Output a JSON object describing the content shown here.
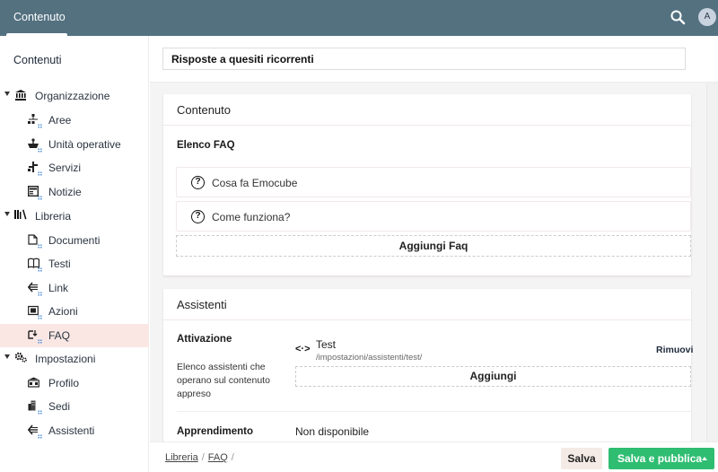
{
  "topbar": {
    "tab_label": "Contenuto",
    "search_icon": "search-icon",
    "avatar_initial": "A"
  },
  "sidebar": {
    "title": "Contenuti",
    "groups": [
      {
        "label": "Organizzazione",
        "icon": "institution-icon",
        "items": [
          {
            "label": "Aree",
            "icon": "sitemap-icon"
          },
          {
            "label": "Unità operative",
            "icon": "unit-icon"
          },
          {
            "label": "Servizi",
            "icon": "services-icon"
          },
          {
            "label": "Notizie",
            "icon": "news-icon"
          }
        ]
      },
      {
        "label": "Libreria",
        "icon": "books-icon",
        "items": [
          {
            "label": "Documenti",
            "icon": "document-icon"
          },
          {
            "label": "Testi",
            "icon": "book-open-icon"
          },
          {
            "label": "Link",
            "icon": "link-icon"
          },
          {
            "label": "Azioni",
            "icon": "actions-icon"
          },
          {
            "label": "FAQ",
            "icon": "faq-icon",
            "active": true
          }
        ]
      },
      {
        "label": "Impostazioni",
        "icon": "gears-icon",
        "items": [
          {
            "label": "Profilo",
            "icon": "profile-icon"
          },
          {
            "label": "Sedi",
            "icon": "buildings-icon"
          },
          {
            "label": "Assistenti",
            "icon": "assistant-icon"
          }
        ]
      }
    ]
  },
  "main": {
    "title_value": "Risposte a quesiti ricorrenti",
    "content_card": {
      "heading": "Contenuto",
      "faq_list_label": "Elenco FAQ",
      "faqs": [
        "Cosa fa Emocube",
        "Come funziona?"
      ],
      "add_faq_label": "Aggiungi Faq"
    },
    "assistants_card": {
      "heading": "Assistenti",
      "activation_label": "Attivazione",
      "activation_description": "Elenco assistenti che operano sul contenuto appreso",
      "assistant": {
        "name": "Test",
        "path": "/impostazioni/assistenti/test/",
        "remove_label": "Rimuovi"
      },
      "add_label": "Aggiungi",
      "learning_label": "Apprendimento",
      "learning_value": "Non disponibile"
    }
  },
  "footer": {
    "breadcrumb": [
      "Libreria",
      "FAQ"
    ],
    "save_label": "Salva",
    "publish_label": "Salva e pubblica"
  },
  "colors": {
    "topbar": "#547180",
    "active_nav": "#fae7e4",
    "publish": "#2fbd72",
    "save": "#f5ebe6"
  }
}
